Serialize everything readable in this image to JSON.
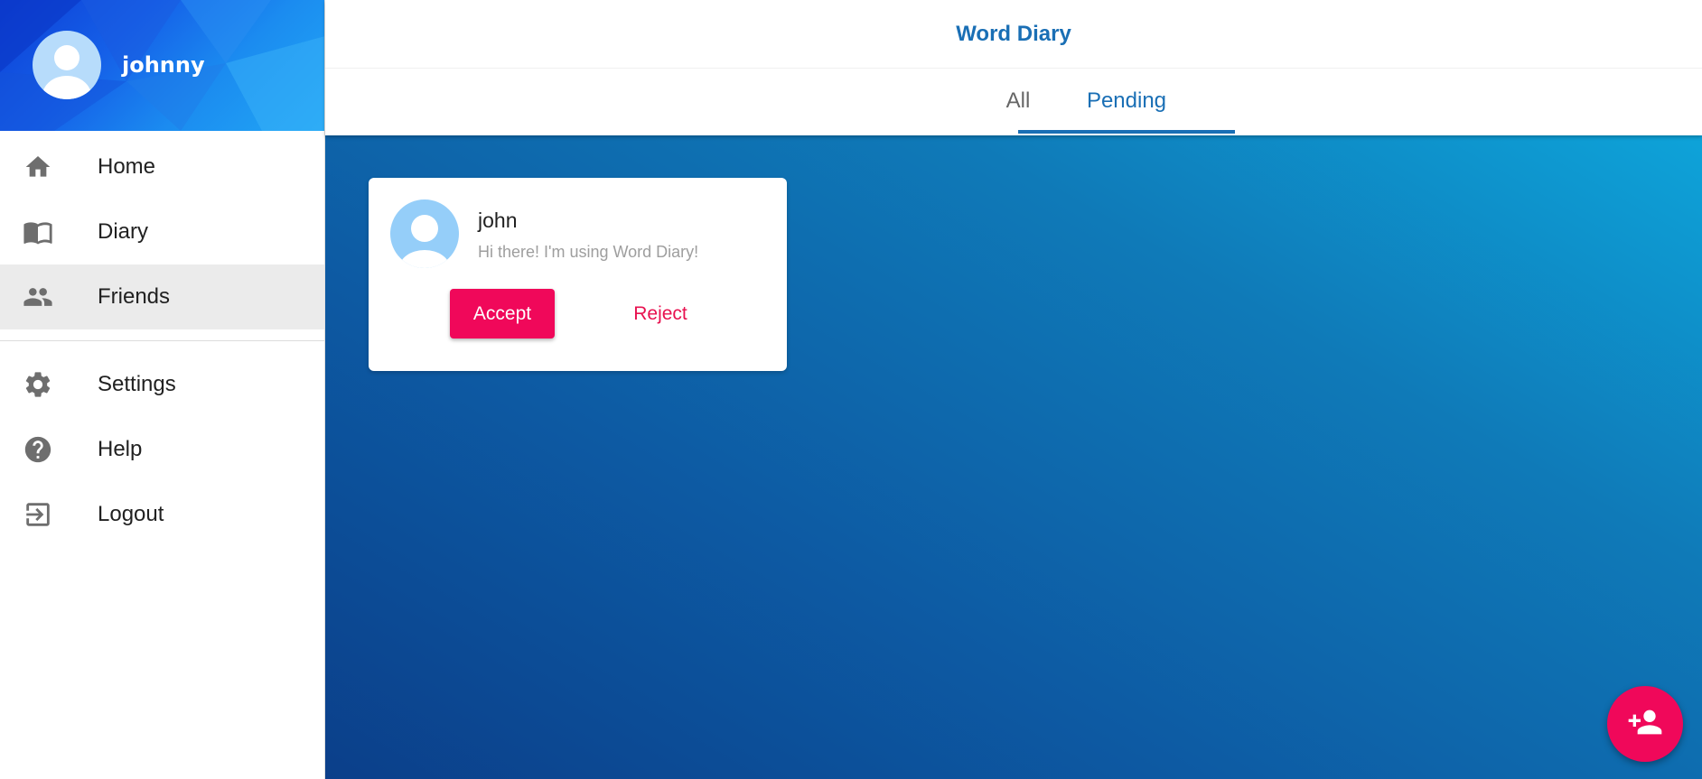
{
  "sidebar": {
    "username": "johnny",
    "items": [
      {
        "label": "Home",
        "icon": "home-icon"
      },
      {
        "label": "Diary",
        "icon": "book-icon"
      },
      {
        "label": "Friends",
        "icon": "people-icon",
        "active": true
      },
      {
        "label": "Settings",
        "icon": "gear-icon"
      },
      {
        "label": "Help",
        "icon": "help-icon"
      },
      {
        "label": "Logout",
        "icon": "logout-icon"
      }
    ]
  },
  "header": {
    "title": "Word Diary",
    "tabs": [
      {
        "label": "All"
      },
      {
        "label": "Pending",
        "active": true
      }
    ]
  },
  "requests": [
    {
      "name": "john",
      "status": "Hi there! I'm using Word Diary!",
      "accept_label": "Accept",
      "reject_label": "Reject"
    }
  ],
  "fab": {
    "icon": "add-person-icon"
  },
  "colors": {
    "primary": "#1a6fb5",
    "accent": "#f0085a"
  }
}
